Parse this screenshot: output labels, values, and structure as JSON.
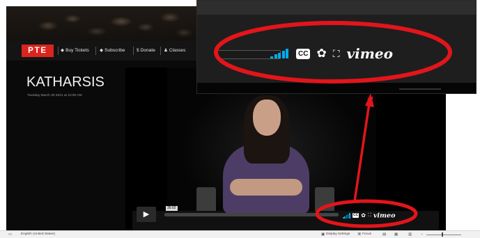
{
  "site": {
    "logo_text": "PTE",
    "nav": [
      {
        "icon": "ticket-icon",
        "glyph": "◆",
        "label": "Buy Tickets"
      },
      {
        "icon": "subscribe-icon",
        "glyph": "◆",
        "label": "Subscribe"
      },
      {
        "icon": "dollar-icon",
        "glyph": "$",
        "label": "Donate"
      },
      {
        "icon": "person-icon",
        "glyph": "♟",
        "label": "Classes"
      }
    ]
  },
  "event": {
    "title": "KATHARSIS",
    "date": "Tuesday March 30 2021 at 10:00 AM"
  },
  "player": {
    "play_glyph": "▶",
    "time": "35:02",
    "cc_label": "CC",
    "gear_glyph": "✿",
    "fullscreen_glyph": "⛶",
    "brand": "vimeo",
    "volume_bars": 5
  },
  "zoom": {
    "cc_label": "CC",
    "gear_glyph": "✿",
    "fullscreen_glyph": "⛶",
    "brand": "vimeo"
  },
  "status_bar": {
    "language": "English (United States)",
    "display_settings": "Display Settings",
    "focus": "Focus"
  },
  "colors": {
    "accent_red": "#d9251d",
    "vimeo_blue": "#00adef",
    "annotation_red": "#e2151b"
  }
}
